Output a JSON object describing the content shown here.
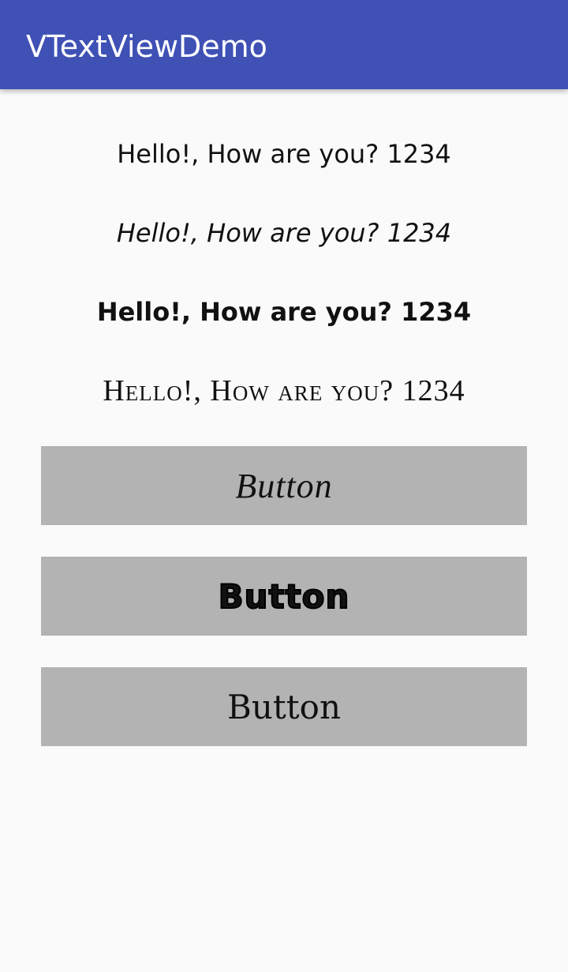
{
  "app_bar": {
    "title": "VTextViewDemo",
    "color": "#3f51b5"
  },
  "texts": [
    {
      "label": "Hello!, How are you? 1234",
      "style": "regular"
    },
    {
      "label": "Hello!, How are you? 1234",
      "style": "italic"
    },
    {
      "label": "Hello!, How are you? 1234",
      "style": "bold"
    },
    {
      "label": "Hello!, How are you? 1234",
      "style": "small-caps serif"
    }
  ],
  "buttons": [
    {
      "label": "Button",
      "style": "script"
    },
    {
      "label": "Button",
      "style": "bubble"
    },
    {
      "label": "Button",
      "style": "curly"
    }
  ],
  "colors": {
    "background": "#fafafa",
    "button_background": "#b3b3b3",
    "text": "#111111"
  }
}
